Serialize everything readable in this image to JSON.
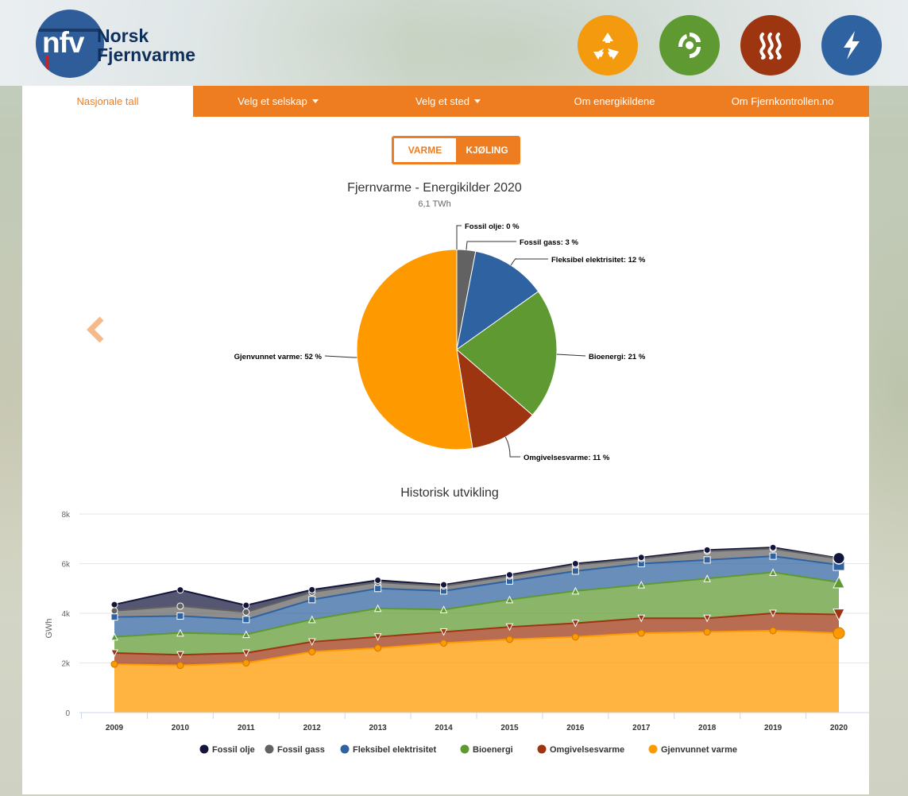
{
  "header": {
    "logo_text": "nfv",
    "brand_line1": "Norsk",
    "brand_line2": "Fjernvarme",
    "icons": [
      {
        "name": "recycle-icon",
        "color": "#f39a0e"
      },
      {
        "name": "bio-icon",
        "color": "#5e9a31"
      },
      {
        "name": "heat-icon",
        "color": "#9d3510"
      },
      {
        "name": "lightning-icon",
        "color": "#2f62a0"
      }
    ]
  },
  "nav": {
    "items": [
      {
        "label": "Nasjonale tall",
        "active": true,
        "dropdown": false
      },
      {
        "label": "Velg et selskap",
        "active": false,
        "dropdown": true
      },
      {
        "label": "Velg et sted",
        "active": false,
        "dropdown": true
      },
      {
        "label": "Om energikildene",
        "active": false,
        "dropdown": false
      },
      {
        "label": "Om Fjernkontrollen.no",
        "active": false,
        "dropdown": false
      }
    ]
  },
  "toggle": {
    "varme": "VARME",
    "kjoling": "KJØLING"
  },
  "chart_data": [
    {
      "type": "pie",
      "title": "Fjernvarme - Energikilder 2020",
      "subtitle": "6,1 TWh",
      "slices": [
        {
          "label": "Fossil olje",
          "value": 0,
          "text": "Fossil olje: 0 %",
          "color": "#14153a"
        },
        {
          "label": "Fossil gass",
          "value": 3,
          "text": "Fossil gass: 3 %",
          "color": "#626262"
        },
        {
          "label": "Fleksibel elektrisitet",
          "value": 12,
          "text": "Fleksibel elektrisitet: 12 %",
          "color": "#2f62a0"
        },
        {
          "label": "Bioenergi",
          "value": 21,
          "text": "Bioenergi: 21 %",
          "color": "#5e9a31"
        },
        {
          "label": "Omgivelsesvarme",
          "value": 11,
          "text": "Omgivelsesvarme: 11 %",
          "color": "#9d3510"
        },
        {
          "label": "Gjenvunnet varme",
          "value": 52,
          "text": "Gjenvunnet varme: 52 %",
          "color": "#ff9900"
        }
      ]
    },
    {
      "type": "area",
      "stacked": true,
      "title": "Historisk utvikling",
      "ylabel": "GWh",
      "ylim": [
        0,
        8000
      ],
      "yticks": [
        0,
        2000,
        4000,
        6000,
        8000
      ],
      "ytick_labels": [
        "0",
        "2k",
        "4k",
        "6k",
        "8k"
      ],
      "x": [
        "2009",
        "2010",
        "2011",
        "2012",
        "2013",
        "2014",
        "2015",
        "2016",
        "2017",
        "2018",
        "2019",
        "2020"
      ],
      "grid": true,
      "legend_position": "bottom",
      "series": [
        {
          "name": "Gjenvunnet varme",
          "color": "#ff9900",
          "marker": "circle",
          "values": [
            1950,
            1900,
            2000,
            2450,
            2600,
            2800,
            2950,
            3050,
            3200,
            3250,
            3300,
            3200
          ]
        },
        {
          "name": "Omgivelsesvarme",
          "color": "#9d3510",
          "marker": "triangle-down",
          "values": [
            450,
            430,
            400,
            400,
            450,
            450,
            500,
            550,
            600,
            550,
            700,
            750
          ]
        },
        {
          "name": "Bioenergi",
          "color": "#5e9a31",
          "marker": "triangle",
          "values": [
            650,
            880,
            750,
            900,
            1150,
            900,
            1100,
            1300,
            1350,
            1600,
            1650,
            1300
          ]
        },
        {
          "name": "Fleksibel elektrisitet",
          "color": "#2f62a0",
          "marker": "square",
          "values": [
            800,
            680,
            600,
            800,
            800,
            750,
            750,
            800,
            850,
            750,
            650,
            700
          ]
        },
        {
          "name": "Fossil gass",
          "color": "#626262",
          "marker": "circle",
          "values": [
            250,
            400,
            300,
            300,
            250,
            200,
            200,
            250,
            200,
            350,
            300,
            250
          ]
        },
        {
          "name": "Fossil olje",
          "color": "#14153a",
          "marker": "circle",
          "values": [
            250,
            650,
            270,
            100,
            80,
            50,
            50,
            50,
            50,
            50,
            50,
            20
          ]
        }
      ],
      "legend_order": [
        "Fossil olje",
        "Fossil gass",
        "Fleksibel elektrisitet",
        "Bioenergi",
        "Omgivelsesvarme",
        "Gjenvunnet varme"
      ]
    }
  ]
}
